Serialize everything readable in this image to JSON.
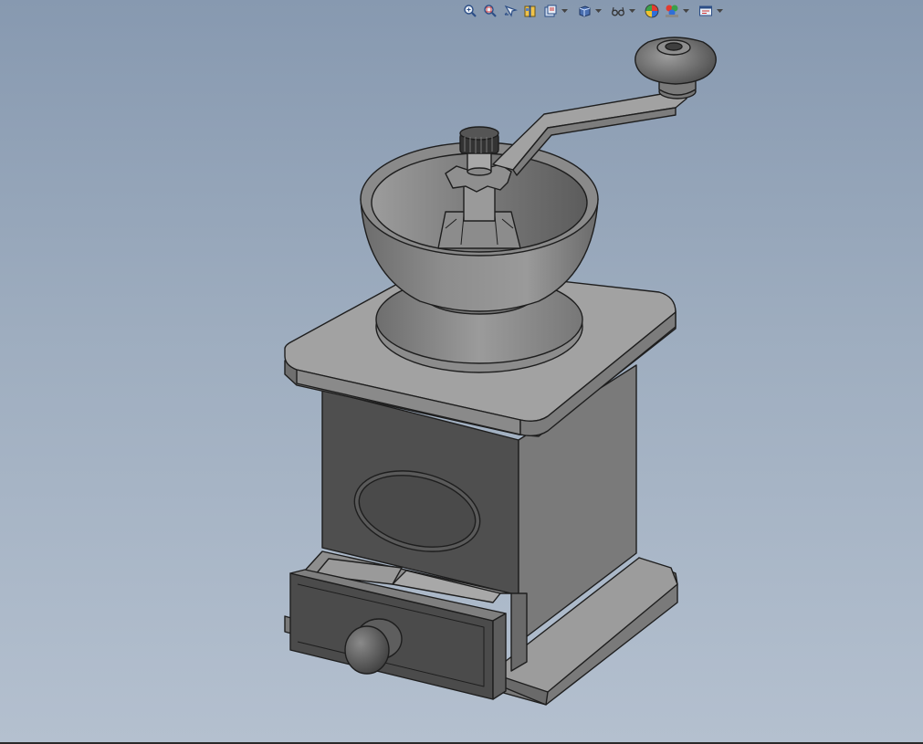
{
  "window": {
    "background_top": "#8799b0",
    "background_bottom": "#b4c0cf"
  },
  "heads_up_toolbar": {
    "buttons": [
      {
        "name": "zoom-to-fit",
        "icon": "zoom-to-fit-icon"
      },
      {
        "name": "zoom-to-area",
        "icon": "zoom-to-area-icon"
      },
      {
        "name": "previous-view",
        "icon": "previous-view-icon"
      },
      {
        "name": "section-view",
        "icon": "section-view-icon"
      },
      {
        "name": "dynamic-annotation-views",
        "icon": "annotation-view-icon"
      },
      {
        "name": "view-orientation",
        "icon": "view-orientation-icon",
        "dropdown": true
      },
      {
        "name": "display-style",
        "icon": "display-style-cube-icon",
        "dropdown": true
      },
      {
        "name": "hide-show-items",
        "icon": "hide-show-glasses-icon",
        "dropdown": true
      },
      {
        "name": "edit-appearance",
        "icon": "appearance-sphere-icon"
      },
      {
        "name": "apply-scene",
        "icon": "scene-icon",
        "dropdown": true
      },
      {
        "name": "view-settings",
        "icon": "view-settings-icon",
        "dropdown": true
      }
    ]
  },
  "model": {
    "name": "coffee-grinder",
    "parts": [
      "crank-knob",
      "crank-handle",
      "top-nut",
      "star-nut",
      "hopper-bowl",
      "bowl-base",
      "top-plate",
      "body-box",
      "oval-plaque",
      "drawer",
      "drawer-knob",
      "base-plate"
    ],
    "shade_light": "#a9a9a9",
    "shade_mid": "#8a8a8a",
    "shade_dark": "#4e4e4e",
    "edge_color": "#1e1e1e"
  }
}
